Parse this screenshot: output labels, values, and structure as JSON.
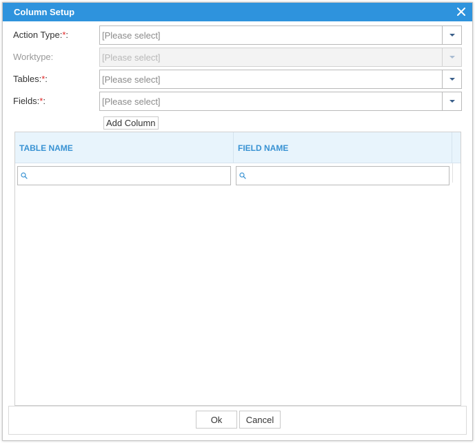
{
  "dialog": {
    "title": "Column Setup"
  },
  "form": {
    "action_type": {
      "label": "Action Type:",
      "required_mark": "*",
      "colon": ":",
      "value": "[Please select]"
    },
    "worktype": {
      "label": "Worktype:",
      "value": "[Please select]"
    },
    "tables": {
      "label": "Tables:",
      "required_mark": "*",
      "colon": ":",
      "value": "[Please select]"
    },
    "fields": {
      "label": "Fields:",
      "required_mark": "*",
      "colon": ":",
      "value": "[Please select]"
    },
    "add_column_label": "Add Column"
  },
  "grid": {
    "columns": [
      "TABLE NAME",
      "FIELD NAME"
    ],
    "filters": [
      {
        "placeholder": "",
        "value": ""
      },
      {
        "placeholder": "",
        "value": ""
      }
    ]
  },
  "footer": {
    "ok_label": "Ok",
    "cancel_label": "Cancel"
  },
  "colors": {
    "titlebar": "#2e93dd",
    "header_bg": "#e8f4fc",
    "header_text": "#3892d3",
    "required": "#e02424"
  },
  "icons": [
    "close-icon",
    "chevron-down-icon",
    "search-icon"
  ]
}
